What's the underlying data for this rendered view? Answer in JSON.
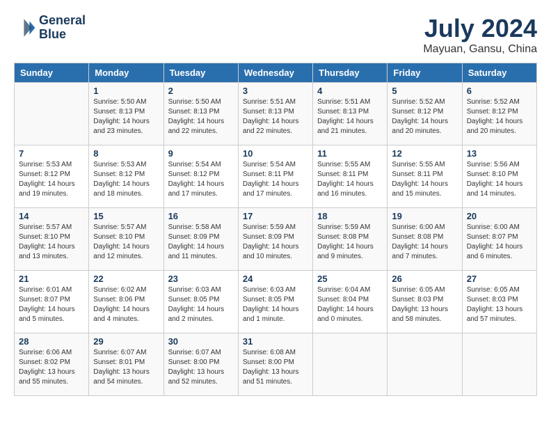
{
  "logo": {
    "line1": "General",
    "line2": "Blue"
  },
  "title": "July 2024",
  "subtitle": "Mayuan, Gansu, China",
  "days_of_week": [
    "Sunday",
    "Monday",
    "Tuesday",
    "Wednesday",
    "Thursday",
    "Friday",
    "Saturday"
  ],
  "weeks": [
    [
      {
        "day": "",
        "info": ""
      },
      {
        "day": "1",
        "info": "Sunrise: 5:50 AM\nSunset: 8:13 PM\nDaylight: 14 hours\nand 23 minutes."
      },
      {
        "day": "2",
        "info": "Sunrise: 5:50 AM\nSunset: 8:13 PM\nDaylight: 14 hours\nand 22 minutes."
      },
      {
        "day": "3",
        "info": "Sunrise: 5:51 AM\nSunset: 8:13 PM\nDaylight: 14 hours\nand 22 minutes."
      },
      {
        "day": "4",
        "info": "Sunrise: 5:51 AM\nSunset: 8:13 PM\nDaylight: 14 hours\nand 21 minutes."
      },
      {
        "day": "5",
        "info": "Sunrise: 5:52 AM\nSunset: 8:12 PM\nDaylight: 14 hours\nand 20 minutes."
      },
      {
        "day": "6",
        "info": "Sunrise: 5:52 AM\nSunset: 8:12 PM\nDaylight: 14 hours\nand 20 minutes."
      }
    ],
    [
      {
        "day": "7",
        "info": "Sunrise: 5:53 AM\nSunset: 8:12 PM\nDaylight: 14 hours\nand 19 minutes."
      },
      {
        "day": "8",
        "info": "Sunrise: 5:53 AM\nSunset: 8:12 PM\nDaylight: 14 hours\nand 18 minutes."
      },
      {
        "day": "9",
        "info": "Sunrise: 5:54 AM\nSunset: 8:12 PM\nDaylight: 14 hours\nand 17 minutes."
      },
      {
        "day": "10",
        "info": "Sunrise: 5:54 AM\nSunset: 8:11 PM\nDaylight: 14 hours\nand 17 minutes."
      },
      {
        "day": "11",
        "info": "Sunrise: 5:55 AM\nSunset: 8:11 PM\nDaylight: 14 hours\nand 16 minutes."
      },
      {
        "day": "12",
        "info": "Sunrise: 5:55 AM\nSunset: 8:11 PM\nDaylight: 14 hours\nand 15 minutes."
      },
      {
        "day": "13",
        "info": "Sunrise: 5:56 AM\nSunset: 8:10 PM\nDaylight: 14 hours\nand 14 minutes."
      }
    ],
    [
      {
        "day": "14",
        "info": "Sunrise: 5:57 AM\nSunset: 8:10 PM\nDaylight: 14 hours\nand 13 minutes."
      },
      {
        "day": "15",
        "info": "Sunrise: 5:57 AM\nSunset: 8:10 PM\nDaylight: 14 hours\nand 12 minutes."
      },
      {
        "day": "16",
        "info": "Sunrise: 5:58 AM\nSunset: 8:09 PM\nDaylight: 14 hours\nand 11 minutes."
      },
      {
        "day": "17",
        "info": "Sunrise: 5:59 AM\nSunset: 8:09 PM\nDaylight: 14 hours\nand 10 minutes."
      },
      {
        "day": "18",
        "info": "Sunrise: 5:59 AM\nSunset: 8:08 PM\nDaylight: 14 hours\nand 9 minutes."
      },
      {
        "day": "19",
        "info": "Sunrise: 6:00 AM\nSunset: 8:08 PM\nDaylight: 14 hours\nand 7 minutes."
      },
      {
        "day": "20",
        "info": "Sunrise: 6:00 AM\nSunset: 8:07 PM\nDaylight: 14 hours\nand 6 minutes."
      }
    ],
    [
      {
        "day": "21",
        "info": "Sunrise: 6:01 AM\nSunset: 8:07 PM\nDaylight: 14 hours\nand 5 minutes."
      },
      {
        "day": "22",
        "info": "Sunrise: 6:02 AM\nSunset: 8:06 PM\nDaylight: 14 hours\nand 4 minutes."
      },
      {
        "day": "23",
        "info": "Sunrise: 6:03 AM\nSunset: 8:05 PM\nDaylight: 14 hours\nand 2 minutes."
      },
      {
        "day": "24",
        "info": "Sunrise: 6:03 AM\nSunset: 8:05 PM\nDaylight: 14 hours\nand 1 minute."
      },
      {
        "day": "25",
        "info": "Sunrise: 6:04 AM\nSunset: 8:04 PM\nDaylight: 14 hours\nand 0 minutes."
      },
      {
        "day": "26",
        "info": "Sunrise: 6:05 AM\nSunset: 8:03 PM\nDaylight: 13 hours\nand 58 minutes."
      },
      {
        "day": "27",
        "info": "Sunrise: 6:05 AM\nSunset: 8:03 PM\nDaylight: 13 hours\nand 57 minutes."
      }
    ],
    [
      {
        "day": "28",
        "info": "Sunrise: 6:06 AM\nSunset: 8:02 PM\nDaylight: 13 hours\nand 55 minutes."
      },
      {
        "day": "29",
        "info": "Sunrise: 6:07 AM\nSunset: 8:01 PM\nDaylight: 13 hours\nand 54 minutes."
      },
      {
        "day": "30",
        "info": "Sunrise: 6:07 AM\nSunset: 8:00 PM\nDaylight: 13 hours\nand 52 minutes."
      },
      {
        "day": "31",
        "info": "Sunrise: 6:08 AM\nSunset: 8:00 PM\nDaylight: 13 hours\nand 51 minutes."
      },
      {
        "day": "",
        "info": ""
      },
      {
        "day": "",
        "info": ""
      },
      {
        "day": "",
        "info": ""
      }
    ]
  ]
}
